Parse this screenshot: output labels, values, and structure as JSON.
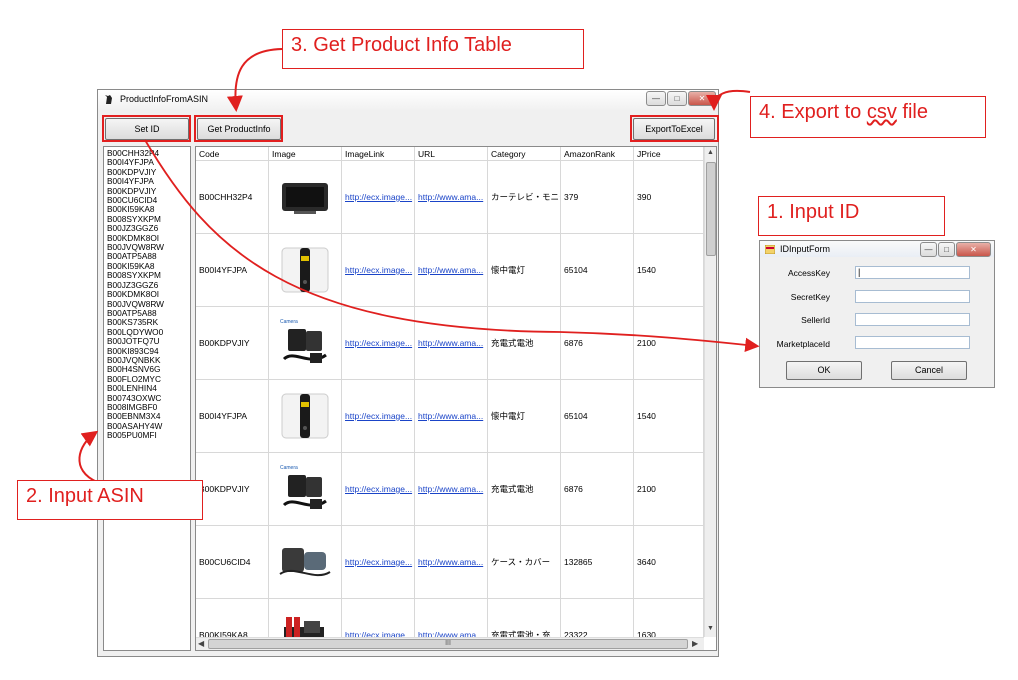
{
  "window": {
    "title": "ProductInfoFromASIN",
    "buttons": {
      "set_id": "Set ID",
      "get_product_info": "Get ProductInfo",
      "export": "ExportToExcel"
    },
    "win_controls": [
      "—",
      "□",
      "✕"
    ]
  },
  "asin_list": [
    "B00CHH32P4",
    "B00I4YFJPA",
    "B00KDPVJIY",
    "B00I4YFJPA",
    "B00KDPVJIY",
    "B00CU6CID4",
    "B00KI59KA8",
    "B008SYXKPM",
    "B00JZ3GGZ6",
    "B00KDMK8OI",
    "B00JVQW8RW",
    "B00ATP5A88",
    "B00KI59KA8",
    "B008SYXKPM",
    "B00JZ3GGZ6",
    "B00KDMK8OI",
    "B00JVQW8RW",
    "B00ATP5A88",
    "B00KS735RK",
    "B00LQDYWO0",
    "B00JOTFQ7U",
    "B00KI893C94",
    "B00JVQNBKK",
    "B00H4SNV6G",
    "B00FLO2MYC",
    "B00LENHIN4",
    "B00743OXWC",
    "B008IMGBF0",
    "B00EBNM3X4",
    "B00ASAHY4W",
    "B005PU0MFI"
  ],
  "grid": {
    "columns": [
      "Code",
      "Image",
      "ImageLink",
      "URL",
      "Category",
      "AmazonRank",
      "JPrice"
    ],
    "rows": [
      {
        "code": "B00CHH32P4",
        "image": "gps-monitor",
        "image_link": "http://ecx.image...",
        "url": "http://www.ama...",
        "category": "カーテレビ・モニタ...",
        "rank": "379",
        "price": "390"
      },
      {
        "code": "B00I4YFJPA",
        "image": "flashlight",
        "image_link": "http://ecx.image...",
        "url": "http://www.ama...",
        "category": "懐中電灯",
        "rank": "65104",
        "price": "1540"
      },
      {
        "code": "B00KDPVJIY",
        "image": "battery-charger",
        "image_link": "http://ecx.image...",
        "url": "http://www.ama...",
        "category": "充電式電池",
        "rank": "6876",
        "price": "2100"
      },
      {
        "code": "B00I4YFJPA",
        "image": "flashlight",
        "image_link": "http://ecx.image...",
        "url": "http://www.ama...",
        "category": "懐中電灯",
        "rank": "65104",
        "price": "1540"
      },
      {
        "code": "B00KDPVJIY",
        "image": "battery-charger",
        "image_link": "http://ecx.image...",
        "url": "http://www.ama...",
        "category": "充電式電池",
        "rank": "6876",
        "price": "2100"
      },
      {
        "code": "B00CU6CID4",
        "image": "case-cover",
        "image_link": "http://ecx.image...",
        "url": "http://www.ama...",
        "category": "ケース・カバー",
        "rank": "132865",
        "price": "3640"
      },
      {
        "code": "B00KI59KA8",
        "image": "battery-set",
        "image_link": "http://ecx.image...",
        "url": "http://www.ama...",
        "category": "充電式電池・充...",
        "rank": "23322",
        "price": "1630"
      }
    ],
    "hscroll_grip": "III"
  },
  "dialog": {
    "title": "IDInputForm",
    "fields": [
      {
        "label": "AccessKey",
        "value": "|"
      },
      {
        "label": "SecretKey",
        "value": ""
      },
      {
        "label": "SellerId",
        "value": ""
      },
      {
        "label": "MarketplaceId",
        "value": ""
      }
    ],
    "ok": "OK",
    "cancel": "Cancel"
  },
  "callouts": {
    "step1": "1. Input ID",
    "step2": "2. Input ASIN",
    "step3": "3. Get Product Info Table",
    "step4_prefix": "4. Export to ",
    "step4_csv": "csv",
    "step4_suffix": " file"
  },
  "colors": {
    "highlight": "#e21f1f",
    "link": "#1a44c8"
  }
}
